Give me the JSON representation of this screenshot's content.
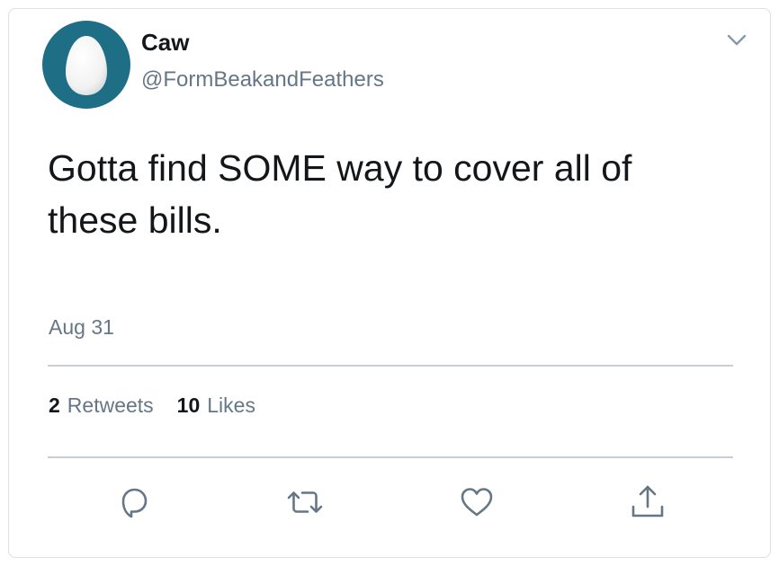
{
  "tweet": {
    "author": {
      "display_name": "Caw",
      "handle": "@FormBeakandFeathers",
      "avatar_icon": "egg-avatar"
    },
    "text": "Gotta find SOME way to cover all of these bills.",
    "timestamp": "Aug 31",
    "stats": {
      "retweets_count": "2",
      "retweets_label": "Retweets",
      "likes_count": "10",
      "likes_label": "Likes"
    },
    "actions": [
      {
        "icon": "reply-icon"
      },
      {
        "icon": "retweet-icon"
      },
      {
        "icon": "like-icon"
      },
      {
        "icon": "share-icon"
      }
    ],
    "menu_icon": "chevron-down-icon"
  },
  "colors": {
    "avatar_bg": "#1e6f86",
    "text_primary": "#14171a",
    "text_secondary": "#657786",
    "icon": "#657786",
    "border": "#dbe0e4"
  }
}
